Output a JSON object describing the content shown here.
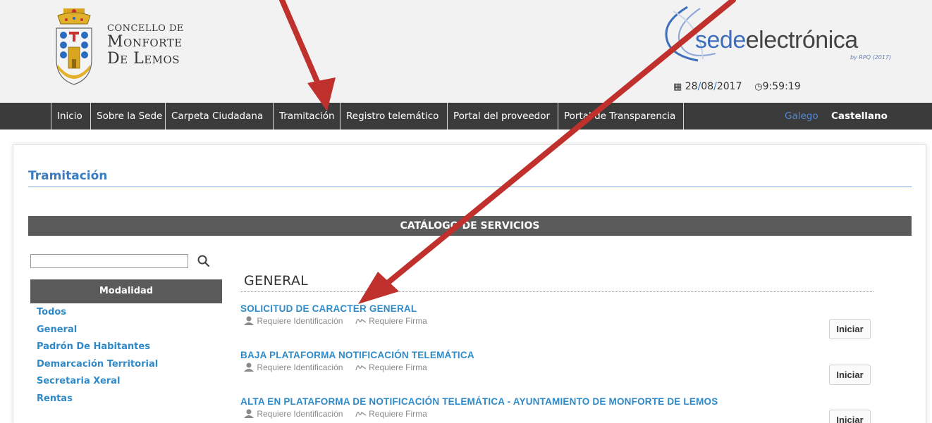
{
  "header": {
    "city": {
      "line1": "CONCELLO DE",
      "line2": "Monforte",
      "line3": "De Lemos"
    },
    "sede": {
      "part1": "sede",
      "part2": "electrónica",
      "by": "by RPQ (2017)"
    },
    "date": {
      "day": "28",
      "month": "08",
      "year": "2017"
    },
    "time": "9:59:19"
  },
  "nav": {
    "items": [
      {
        "label": "Inicio"
      },
      {
        "label": "Sobre la Sede"
      },
      {
        "label": "Carpeta Ciudadana"
      },
      {
        "label": "Tramitación"
      },
      {
        "label": "Registro telemático"
      },
      {
        "label": "Portal del proveedor"
      },
      {
        "label": "Portal de Transparencia"
      }
    ],
    "languages": {
      "galego": "Galego",
      "castellano": "Castellano"
    }
  },
  "page": {
    "title": "Tramitación",
    "catalog_heading": "CATÁLOGO DE SERVICIOS"
  },
  "search": {
    "value": ""
  },
  "filters": {
    "heading": "Modalidad",
    "items": [
      "Todos",
      "General",
      "Padrón De Habitantes",
      "Demarcación Territorial",
      "Secretaria Xeral",
      "Rentas"
    ]
  },
  "section": {
    "title": "GENERAL"
  },
  "services": [
    {
      "title": "SOLICITUD DE CARACTER GENERAL",
      "req_id": "Requiere Identificación",
      "req_sign": "Requiere Firma",
      "button": "Iniciar"
    },
    {
      "title": "BAJA PLATAFORMA NOTIFICACIÓN TELEMÁTICA",
      "req_id": "Requiere Identificación",
      "req_sign": "Requiere Firma",
      "button": "Iniciar"
    },
    {
      "title": "ALTA EN PLATAFORMA DE NOTIFICACIÓN TELEMÁTICA - AYUNTAMIENTO DE MONFORTE DE LEMOS",
      "req_id": "Requiere Identificación",
      "req_sign": "Requiere Firma",
      "button": "Iniciar"
    }
  ],
  "colors": {
    "nav_bg": "#3b3b3b",
    "link_blue": "#2e8ac9",
    "title_blue": "#3a7cc3",
    "arrow_red": "#c0302c"
  }
}
